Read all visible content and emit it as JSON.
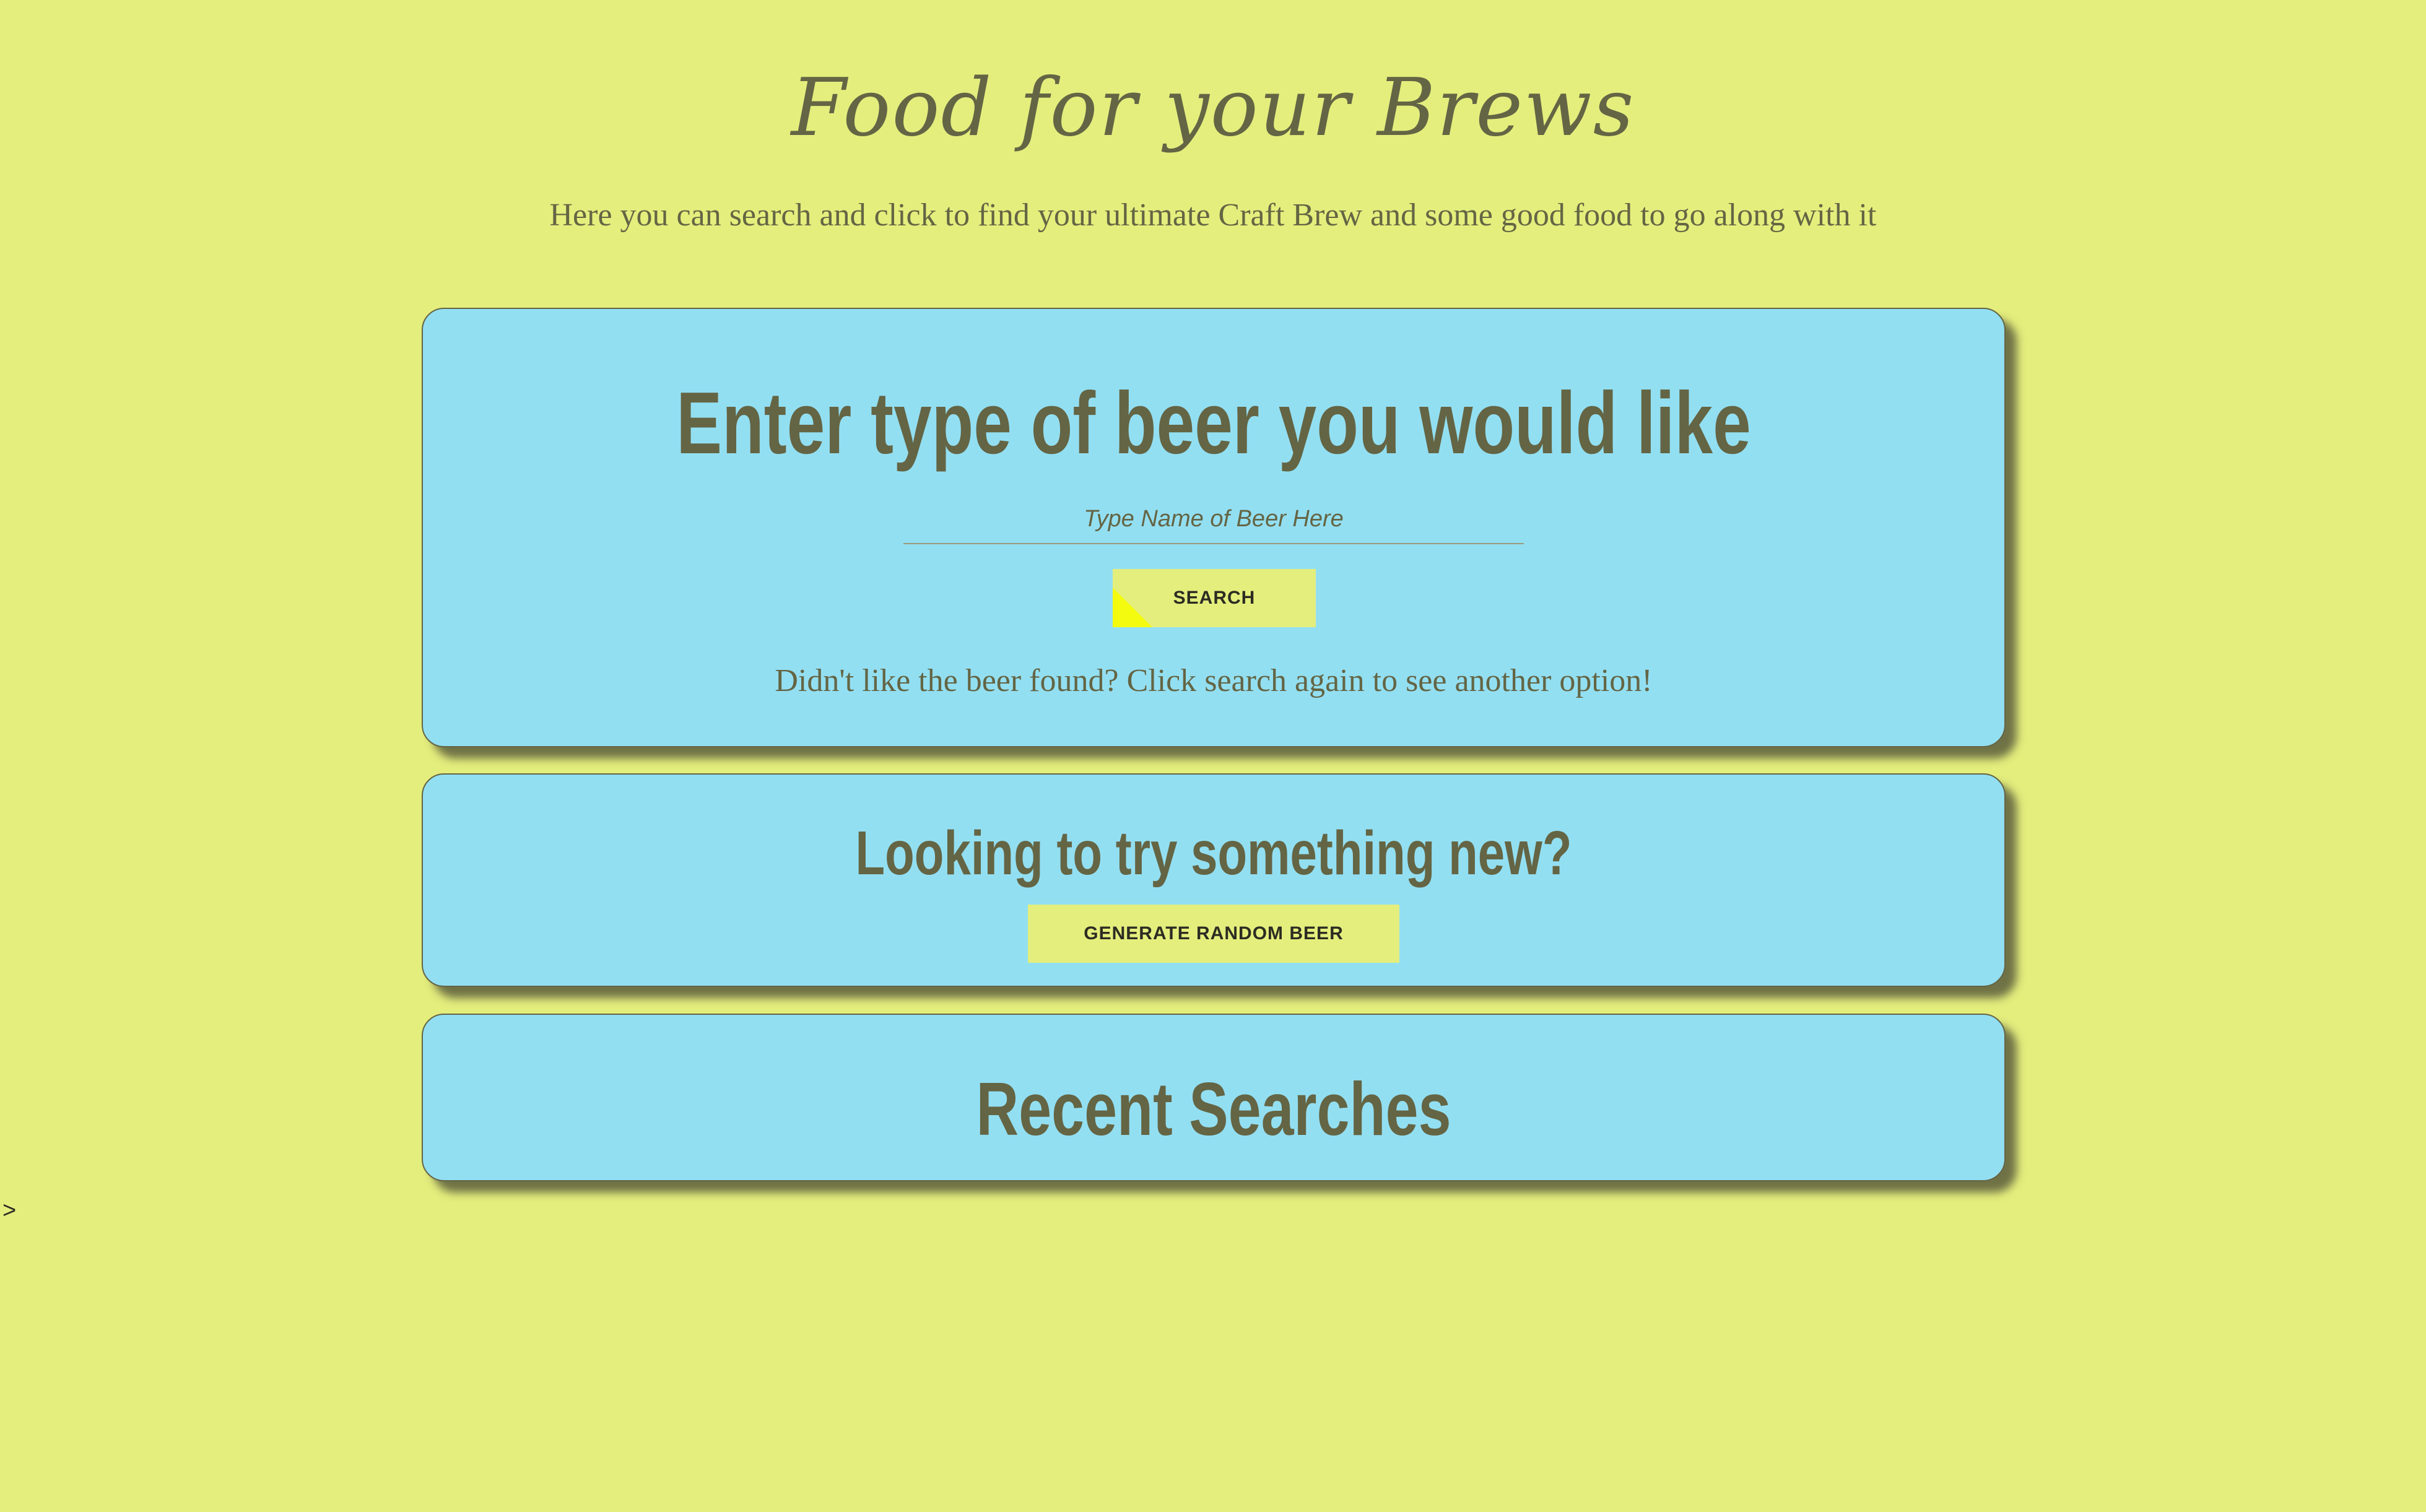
{
  "header": {
    "title": "Food for your Brews",
    "subtitle": "Here you can search and click to find your ultimate Craft Brew and some good food to go along with it"
  },
  "search_card": {
    "heading": "Enter type of beer you would like",
    "input_placeholder": "Type Name of Beer Here",
    "input_value": "",
    "button_label": "SEARCH",
    "hint": "Didn't like the beer found? Click search again to see another option!"
  },
  "random_card": {
    "heading": "Looking to try something new?",
    "button_label": "GENERATE RANDOM BEER"
  },
  "recent_card": {
    "heading": "Recent Searches",
    "items": []
  },
  "stray_text": ">",
  "colors": {
    "background": "#e4ee7d",
    "card": "#93dff2",
    "text": "#646544",
    "button": "#e4ee7d",
    "button_accent": "#f4fb0f"
  }
}
